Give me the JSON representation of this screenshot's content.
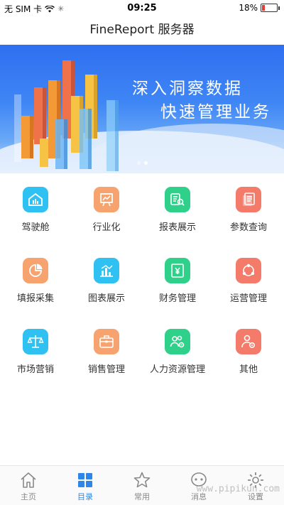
{
  "status_bar": {
    "carrier": "无 SIM 卡",
    "time": "09:25",
    "battery_percent": "18%",
    "battery_level": 0.18,
    "battery_color": "#e53935"
  },
  "nav": {
    "title": "FineReport 服务器"
  },
  "banner": {
    "line1": "深入洞察数据",
    "line2": "快速管理业务",
    "page_count": 2,
    "active_page": 2,
    "background": "#3f86f5"
  },
  "grid": [
    {
      "label": "驾驶舱",
      "icon": "house-chart-icon",
      "color": "#2fc1f2"
    },
    {
      "label": "行业化",
      "icon": "easel-chart-icon",
      "color": "#f7a36f"
    },
    {
      "label": "报表展示",
      "icon": "magnifier-list-icon",
      "color": "#2ed08a"
    },
    {
      "label": "参数查询",
      "icon": "documents-icon",
      "color": "#f47a6a"
    },
    {
      "label": "填报采集",
      "icon": "pie-chart-icon",
      "color": "#f7a36f"
    },
    {
      "label": "图表展示",
      "icon": "bar-chart-icon",
      "color": "#2fc1f2"
    },
    {
      "label": "财务管理",
      "icon": "yen-document-icon",
      "color": "#2ed08a"
    },
    {
      "label": "运营管理",
      "icon": "cycle-nodes-icon",
      "color": "#f47a6a"
    },
    {
      "label": "市场营销",
      "icon": "scale-icon",
      "color": "#2fc1f2"
    },
    {
      "label": "销售管理",
      "icon": "briefcase-icon",
      "color": "#f7a36f"
    },
    {
      "label": "人力资源管理",
      "icon": "people-gear-icon",
      "color": "#2ed08a"
    },
    {
      "label": "其他",
      "icon": "person-gear-icon",
      "color": "#f47a6a"
    }
  ],
  "tabs": [
    {
      "label": "主页",
      "icon": "home-icon"
    },
    {
      "label": "目录",
      "icon": "grid-icon",
      "active": true
    },
    {
      "label": "常用",
      "icon": "star-icon"
    },
    {
      "label": "消息",
      "icon": "chat-icon"
    },
    {
      "label": "设置",
      "icon": "gear-icon"
    }
  ],
  "colors": {
    "active_tab": "#2e86e8",
    "inactive_tab": "#888888"
  },
  "watermark": "www.pipikun.com"
}
